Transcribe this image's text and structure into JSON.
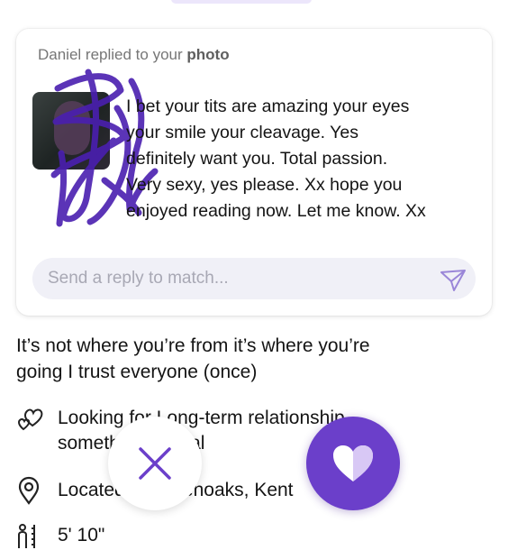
{
  "notification_card": {
    "header_prefix": "Daniel replied to your ",
    "header_emphasis": "photo",
    "message_lines": [
      "I bet your tits are amazing your eyes",
      "your smile your cleavage. Yes",
      "definitely want you. Total passion.",
      "Very sexy, yes please. Xx hope you",
      "enjoyed reading now. Let me know. Xx"
    ],
    "reply_placeholder": "Send a reply to match..."
  },
  "profile": {
    "bio_lines": [
      "It’s not  where  you’re from it’s where you’re",
      "going  I trust everyone (once)"
    ],
    "looking_for_line1": "Looking for Long-term relationship,",
    "looking_for_line2": "something casual",
    "location": "Located in Sevenoaks, Kent",
    "height": "5' 10\""
  },
  "actions": {
    "pass_icon": "close-icon",
    "like_icon": "heart-icon"
  },
  "colors": {
    "accent": "#6b3fca",
    "scribble": "#4a1fb0"
  }
}
